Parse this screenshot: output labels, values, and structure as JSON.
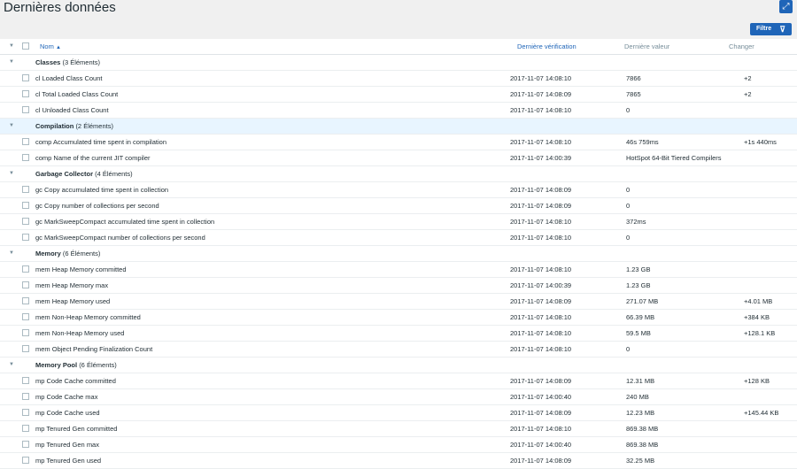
{
  "page": {
    "title": "Dernières données"
  },
  "toolbar": {
    "filter_label": "Filtre",
    "fullscreen_icon": "expand-icon",
    "filter_icon": "funnel-icon"
  },
  "table": {
    "headers": {
      "name": "Nom",
      "sort_indicator": "▲",
      "last_check": "Dernière vérification",
      "last_value": "Dernière valeur",
      "change": "Changer"
    },
    "groups": [
      {
        "name": "Classes",
        "count": "(3 Éléments)",
        "highlighted": false,
        "items": [
          {
            "name": "cl Loaded Class Count",
            "time": "2017-11-07 14:08:10",
            "value": "7866",
            "change": "+2"
          },
          {
            "name": "cl Total Loaded Class Count",
            "time": "2017-11-07 14:08:09",
            "value": "7865",
            "change": "+2"
          },
          {
            "name": "cl Unloaded Class Count",
            "time": "2017-11-07 14:08:10",
            "value": "0",
            "change": ""
          }
        ]
      },
      {
        "name": "Compilation",
        "count": "(2 Éléments)",
        "highlighted": true,
        "items": [
          {
            "name": "comp Accumulated time spent in compilation",
            "time": "2017-11-07 14:08:10",
            "value": "46s 759ms",
            "change": "+1s 440ms"
          },
          {
            "name": "comp Name of the current JIT compiler",
            "time": "2017-11-07 14:00:39",
            "value": "HotSpot 64-Bit Tiered Compilers",
            "change": ""
          }
        ]
      },
      {
        "name": "Garbage Collector",
        "count": "(4 Éléments)",
        "highlighted": false,
        "items": [
          {
            "name": "gc Copy accumulated time spent in collection",
            "time": "2017-11-07 14:08:09",
            "value": "0",
            "change": ""
          },
          {
            "name": "gc Copy number of collections per second",
            "time": "2017-11-07 14:08:09",
            "value": "0",
            "change": ""
          },
          {
            "name": "gc MarkSweepCompact accumulated time spent in collection",
            "time": "2017-11-07 14:08:10",
            "value": "372ms",
            "change": ""
          },
          {
            "name": "gc MarkSweepCompact number of collections per second",
            "time": "2017-11-07 14:08:10",
            "value": "0",
            "change": ""
          }
        ]
      },
      {
        "name": "Memory",
        "count": "(6 Éléments)",
        "highlighted": false,
        "items": [
          {
            "name": "mem Heap Memory committed",
            "time": "2017-11-07 14:08:10",
            "value": "1.23 GB",
            "change": ""
          },
          {
            "name": "mem Heap Memory max",
            "time": "2017-11-07 14:00:39",
            "value": "1.23 GB",
            "change": ""
          },
          {
            "name": "mem Heap Memory used",
            "time": "2017-11-07 14:08:09",
            "value": "271.07 MB",
            "change": "+4.01 MB"
          },
          {
            "name": "mem Non-Heap Memory committed",
            "time": "2017-11-07 14:08:10",
            "value": "66.39 MB",
            "change": "+384 KB"
          },
          {
            "name": "mem Non-Heap Memory used",
            "time": "2017-11-07 14:08:10",
            "value": "59.5 MB",
            "change": "+128.1 KB"
          },
          {
            "name": "mem Object Pending Finalization Count",
            "time": "2017-11-07 14:08:10",
            "value": "0",
            "change": ""
          }
        ]
      },
      {
        "name": "Memory Pool",
        "count": "(6 Éléments)",
        "highlighted": false,
        "items": [
          {
            "name": "mp Code Cache committed",
            "time": "2017-11-07 14:08:09",
            "value": "12.31 MB",
            "change": "+128 KB"
          },
          {
            "name": "mp Code Cache max",
            "time": "2017-11-07 14:00:40",
            "value": "240 MB",
            "change": ""
          },
          {
            "name": "mp Code Cache used",
            "time": "2017-11-07 14:08:09",
            "value": "12.23 MB",
            "change": "+145.44 KB"
          },
          {
            "name": "mp Tenured Gen committed",
            "time": "2017-11-07 14:08:10",
            "value": "869.38 MB",
            "change": ""
          },
          {
            "name": "mp Tenured Gen max",
            "time": "2017-11-07 14:00:40",
            "value": "869.38 MB",
            "change": ""
          },
          {
            "name": "mp Tenured Gen used",
            "time": "2017-11-07 14:08:09",
            "value": "32.25 MB",
            "change": ""
          }
        ]
      }
    ]
  }
}
